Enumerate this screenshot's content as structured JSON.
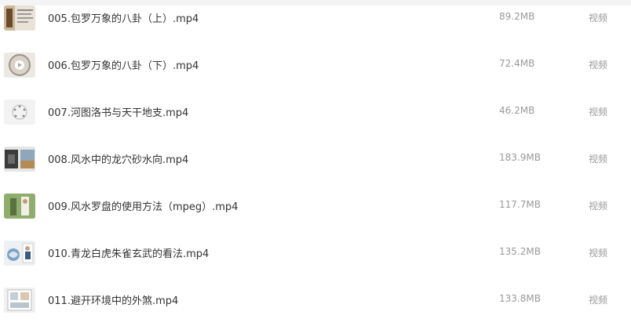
{
  "files": [
    {
      "name": "005.包罗万象的八卦（上）.mp4",
      "size": "89.2MB",
      "type": "视频",
      "thumb_icon": "video-thumbnail-icon"
    },
    {
      "name": "006.包罗万象的八卦（下）.mp4",
      "size": "72.4MB",
      "type": "视频",
      "thumb_icon": "video-thumbnail-icon"
    },
    {
      "name": "007.河图洛书与天干地支.mp4",
      "size": "46.2MB",
      "type": "视频",
      "thumb_icon": "video-thumbnail-icon"
    },
    {
      "name": "008.风水中的龙穴砂水向.mp4",
      "size": "183.9MB",
      "type": "视频",
      "thumb_icon": "video-thumbnail-icon"
    },
    {
      "name": "009.风水罗盘的使用方法（mpeg）.mp4",
      "size": "117.7MB",
      "type": "视频",
      "thumb_icon": "video-thumbnail-icon"
    },
    {
      "name": "010.青龙白虎朱雀玄武的看法.mp4",
      "size": "135.2MB",
      "type": "视频",
      "thumb_icon": "video-thumbnail-icon"
    },
    {
      "name": "011.避开环境中的外煞.mp4",
      "size": "133.8MB",
      "type": "视频",
      "thumb_icon": "video-thumbnail-icon"
    }
  ]
}
